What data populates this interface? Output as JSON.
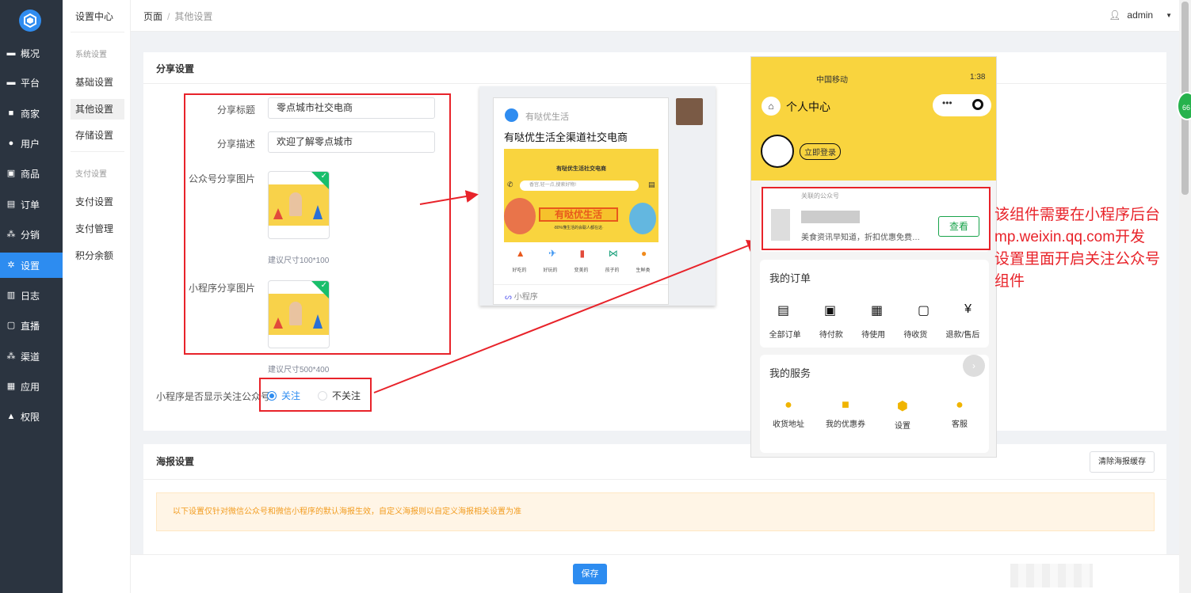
{
  "sidebar": {
    "items": [
      {
        "label": "概况",
        "icon": "monitor-icon"
      },
      {
        "label": "平台",
        "icon": "screen-icon"
      },
      {
        "label": "商家",
        "icon": "store-icon"
      },
      {
        "label": "用户",
        "icon": "user-icon"
      },
      {
        "label": "商品",
        "icon": "goods-icon"
      },
      {
        "label": "订单",
        "icon": "order-icon"
      },
      {
        "label": "分销",
        "icon": "share-icon"
      },
      {
        "label": "设置",
        "icon": "gear-icon"
      },
      {
        "label": "日志",
        "icon": "log-icon"
      },
      {
        "label": "直播",
        "icon": "live-icon"
      },
      {
        "label": "渠道",
        "icon": "channel-icon"
      },
      {
        "label": "应用",
        "icon": "apps-icon"
      },
      {
        "label": "权限",
        "icon": "lock-icon"
      }
    ],
    "active_index": 7,
    "accent": "#2d8cf0",
    "bg": "#2b3440"
  },
  "submenu": {
    "title": "设置中心",
    "group1": "系统设置",
    "items1": [
      "基础设置",
      "其他设置",
      "存储设置"
    ],
    "group2": "支付设置",
    "items2": [
      "支付设置",
      "支付管理",
      "积分余额"
    ]
  },
  "topbar": {
    "crumb_root": "页面",
    "crumb_sep": "/",
    "crumb_current": "其他设置",
    "user": "admin"
  },
  "share": {
    "title": "分享设置",
    "share_title_label": "分享标题",
    "share_title_value": "零点城市社交电商",
    "share_desc_label": "分享描述",
    "share_desc_value": "欢迎了解零点城市",
    "mp_image_label": "公众号分享图片",
    "mp_image_hint": "建议尺寸100*100",
    "mini_image_label": "小程序分享图片",
    "mini_image_hint": "建议尺寸500*400",
    "follow_label": "小程序是否显示关注公众号",
    "follow_option_yes": "关注",
    "follow_option_no": "不关注"
  },
  "share_preview": {
    "app_name": "有哒优生活",
    "headline": "有哒优生活全渠道社交电商",
    "banner_title": "有哒优生活社交电商",
    "search_placeholder": "香宫,轻一点,搜索好物!",
    "brand": "有哒优生活",
    "slogan": "·80%懂生活的会聪人都在这·",
    "cats": [
      "好吃的",
      "好玩的",
      "变美的",
      "孩子的",
      "生鲜类"
    ],
    "footer": "小程序"
  },
  "phone": {
    "status": "中国移动",
    "time": "1:38",
    "header": "个人中心",
    "login": "立即登录",
    "follow_title": "关联的公众号",
    "follow_desc": "美食资讯早知道，折扣优惠免费…",
    "follow_btn": "查看",
    "orders_title": "我的订单",
    "orders": [
      "全部订单",
      "待付款",
      "待使用",
      "待收货",
      "退款/售后"
    ],
    "services_title": "我的服务",
    "services": [
      "收货地址",
      "我的优惠券",
      "设置",
      "客服"
    ]
  },
  "annotation": {
    "lines": [
      "该组件需要在小程序后台",
      "mp.weixin.qq.com开发",
      "设置里面开启关注公众号",
      "组件"
    ]
  },
  "poster": {
    "title": "海报设置",
    "clear_btn": "清除海报缓存",
    "notice": "以下设置仅针对微信公众号和微信小程序的默认海报生效，自定义海报则以自定义海报相关设置为准"
  },
  "save_label": "保存"
}
